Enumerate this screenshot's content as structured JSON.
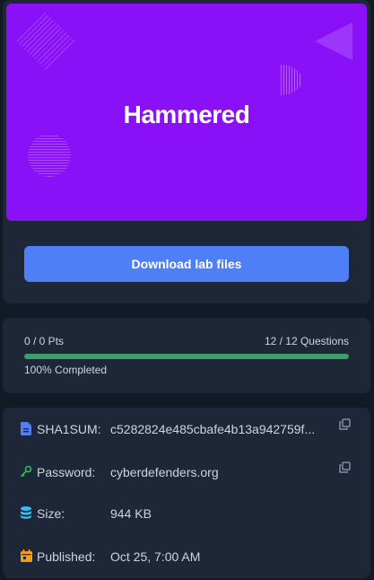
{
  "lab": {
    "title": "Hammered",
    "download_label": "Download lab files"
  },
  "progress": {
    "points": "0 / 0 Pts",
    "questions": "12 / 12 Questions",
    "completed_label": "100% Completed",
    "fraction": 1.0,
    "bar_color": "#3aa06a"
  },
  "info": {
    "sha1_label": "SHA1SUM:",
    "sha1_value": "c5282824e485cbafe4b13a942759f...",
    "password_label": "Password:",
    "password_value": "cyberdefenders.org",
    "size_label": "Size:",
    "size_value": "944 KB",
    "published_label": "Published:",
    "published_value": "Oct 25, 7:00 AM"
  },
  "icons": {
    "sha1": "file-icon",
    "password": "key-icon",
    "size": "database-icon",
    "published": "calendar-icon",
    "copy": "copy-icon"
  },
  "colors": {
    "banner": "#8a10f7",
    "download_button": "#4f7ff7",
    "file_icon": "#4f7ff7",
    "key_icon": "#22c55e",
    "database_icon": "#38bdf8",
    "calendar_icon": "#f59e0b"
  }
}
